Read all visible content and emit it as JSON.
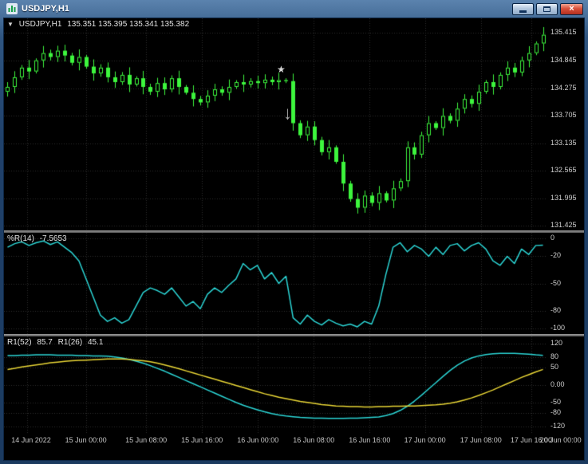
{
  "window": {
    "title": "USDJPY,H1"
  },
  "icons": {
    "dropdown_glyph": "▼",
    "star_glyph": "★",
    "arrow_down_glyph": "↓",
    "close_glyph": "×"
  },
  "colors": {
    "background": "#000000",
    "grid": "#2e2e2e",
    "candle_green": "#3df53d",
    "wpr_cyan": "#2bd5d5",
    "r1_fast_cyan": "#2bd5d5",
    "r1_slow_yellow": "#e8d535",
    "axis_text": "#cdcdcd",
    "titlebar_navy": "#1b3a5f",
    "close_button_red": "#b23020"
  },
  "time_axis": {
    "labels": [
      "14 Jun 2022",
      "15 Jun 00:00",
      "15 Jun 08:00",
      "15 Jun 16:00",
      "16 Jun 00:00",
      "16 Jun 08:00",
      "16 Jun 16:00",
      "17 Jun 00:00",
      "17 Jun 08:00",
      "17 Jun 16:00",
      "20 Jun 00:00"
    ],
    "positions": [
      0.043,
      0.151,
      0.262,
      0.365,
      0.468,
      0.571,
      0.674,
      0.776,
      0.879,
      0.972,
      1.026
    ]
  },
  "chart_data": [
    {
      "type": "candlestick",
      "title": "USDJPY,H1",
      "ohlc_text": "135.351 135.395 135.341 135.382",
      "open_first": 134.2,
      "y_range": [
        135.72,
        131.33
      ],
      "y_ticks": [
        135.415,
        134.845,
        134.275,
        133.705,
        133.135,
        132.565,
        131.995,
        131.425
      ],
      "y_tick_labels": [
        "135.415",
        "134.845",
        "134.275",
        "133.705",
        "133.135",
        "132.565",
        "131.995",
        "131.425"
      ],
      "closes": [
        134.3,
        134.5,
        134.7,
        134.62,
        134.85,
        135.0,
        134.92,
        135.05,
        134.95,
        134.8,
        134.92,
        134.72,
        134.58,
        134.7,
        134.5,
        134.4,
        134.55,
        134.35,
        134.48,
        134.3,
        134.2,
        134.38,
        134.25,
        134.48,
        134.3,
        134.18,
        134.05,
        133.98,
        134.12,
        134.25,
        134.18,
        134.3,
        134.4,
        134.35,
        134.42,
        134.38,
        134.45,
        134.4,
        134.44,
        134.42,
        133.55,
        133.3,
        133.48,
        133.2,
        132.95,
        133.05,
        132.75,
        132.3,
        131.98,
        131.8,
        132.05,
        131.9,
        132.1,
        131.95,
        132.2,
        132.35,
        133.05,
        132.9,
        133.3,
        133.55,
        133.45,
        133.7,
        133.6,
        133.85,
        134.05,
        133.95,
        134.2,
        134.4,
        134.3,
        134.55,
        134.7,
        134.6,
        134.85,
        135.0,
        135.2,
        135.38
      ],
      "annotations": [
        {
          "icon": "star",
          "bar": 38.9,
          "price": 134.6
        },
        {
          "icon": "arrow-down",
          "bar": 39.8,
          "price": 133.75
        }
      ]
    },
    {
      "type": "line",
      "name": "%R(14)",
      "value": "-7.5653",
      "y_range": [
        6,
        -106
      ],
      "y_ticks": [
        0,
        -20,
        -50,
        -80,
        -100
      ],
      "y_tick_labels": [
        "0",
        "-20",
        "-50",
        "-80",
        "-100"
      ],
      "values": [
        -10,
        -6,
        -4,
        -8,
        -5,
        -3,
        -7,
        -4,
        -10,
        -16,
        -25,
        -45,
        -65,
        -85,
        -92,
        -88,
        -94,
        -90,
        -75,
        -60,
        -55,
        -58,
        -62,
        -55,
        -65,
        -75,
        -70,
        -78,
        -62,
        -55,
        -60,
        -52,
        -45,
        -28,
        -35,
        -30,
        -45,
        -38,
        -50,
        -42,
        -88,
        -95,
        -85,
        -92,
        -96,
        -90,
        -94,
        -97,
        -95,
        -98,
        -92,
        -95,
        -75,
        -40,
        -10,
        -5,
        -15,
        -8,
        -12,
        -20,
        -10,
        -18,
        -8,
        -6,
        -14,
        -8,
        -5,
        -12,
        -25,
        -30,
        -20,
        -28,
        -12,
        -18,
        -8,
        -7.57
      ]
    },
    {
      "type": "line",
      "label_series": [
        {
          "name": "R1(52)",
          "value": "85.7"
        },
        {
          "name": "R1(26)",
          "value": "45.1"
        }
      ],
      "y_range": [
        140,
        -140
      ],
      "y_ticks": [
        120,
        80,
        50,
        0,
        -50,
        -80,
        -120
      ],
      "y_tick_labels": [
        "120",
        "80",
        "50",
        "0.00",
        "-50",
        "-80",
        "-120"
      ],
      "series": [
        {
          "name": "R1(52)",
          "color": "#2bd5d5",
          "values": [
            85,
            85,
            86,
            86,
            87,
            87,
            87,
            86,
            86,
            86,
            85,
            85,
            84,
            84,
            83,
            81,
            78,
            74,
            69,
            63,
            56,
            48,
            40,
            31,
            22,
            13,
            4,
            -5,
            -14,
            -23,
            -32,
            -41,
            -50,
            -58,
            -65,
            -71,
            -77,
            -82,
            -86,
            -89,
            -91,
            -93,
            -94,
            -95,
            -95,
            -96,
            -96,
            -96,
            -95,
            -95,
            -94,
            -93,
            -92,
            -88,
            -82,
            -73,
            -61,
            -46,
            -29,
            -11,
            7,
            25,
            42,
            57,
            69,
            78,
            84,
            88,
            90,
            91,
            91,
            91,
            90,
            89,
            87,
            85.7
          ]
        },
        {
          "name": "R1(26)",
          "color": "#e8d535",
          "values": [
            45,
            48,
            52,
            55,
            58,
            61,
            64,
            66,
            68,
            70,
            71,
            72,
            73,
            74,
            75,
            75,
            75,
            74,
            72,
            70,
            67,
            63,
            58,
            53,
            47,
            41,
            35,
            29,
            23,
            17,
            11,
            5,
            -1,
            -7,
            -13,
            -19,
            -25,
            -30,
            -35,
            -39,
            -43,
            -47,
            -50,
            -53,
            -56,
            -58,
            -60,
            -61,
            -62,
            -62,
            -63,
            -63,
            -62,
            -62,
            -61,
            -61,
            -60,
            -60,
            -59,
            -58,
            -57,
            -55,
            -52,
            -48,
            -43,
            -37,
            -30,
            -22,
            -14,
            -5,
            4,
            13,
            22,
            30,
            38,
            45.1
          ]
        }
      ]
    }
  ]
}
